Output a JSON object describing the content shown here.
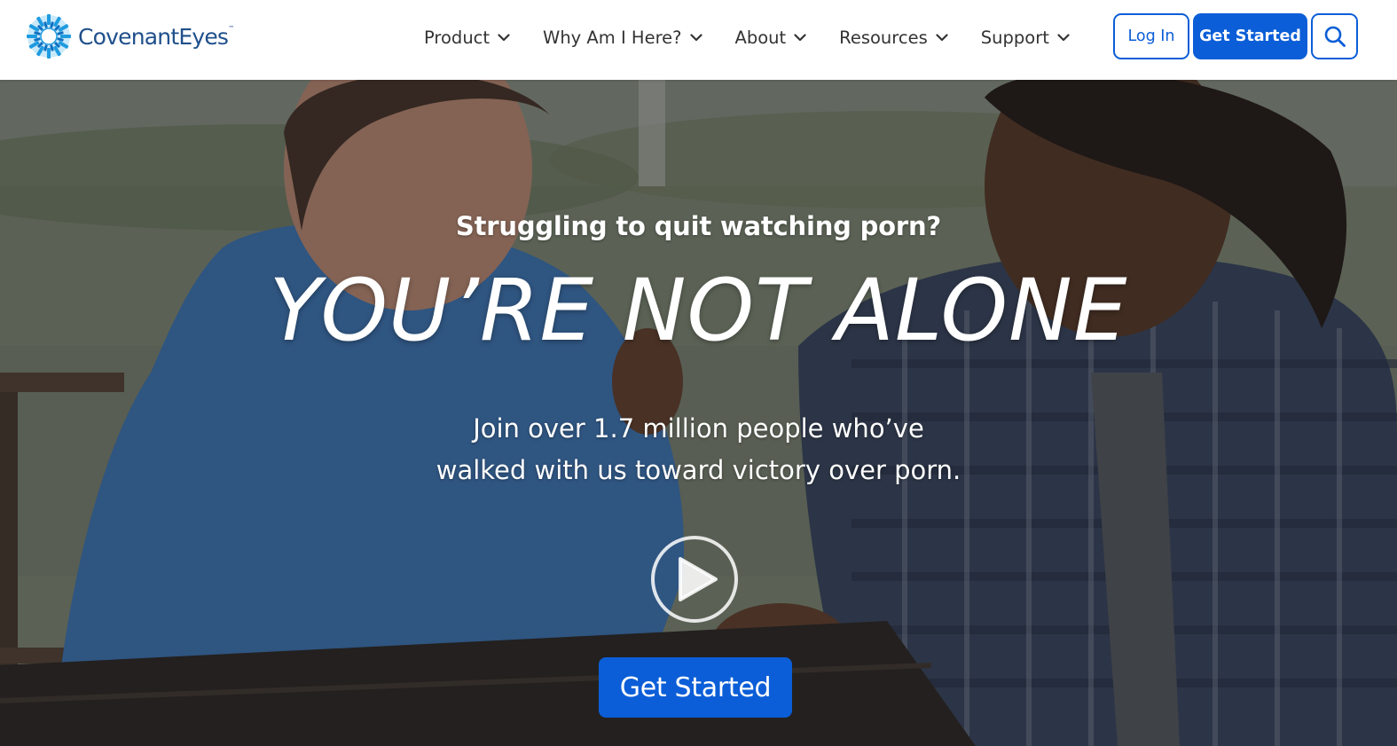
{
  "brand": {
    "name": "CovenantEyes",
    "trademark": "™",
    "primary_color": "#0b5ed7",
    "logo_color": "#1f4f8b"
  },
  "nav": {
    "items": [
      {
        "label": "Product"
      },
      {
        "label": "Why Am I Here?"
      },
      {
        "label": "About"
      },
      {
        "label": "Resources"
      },
      {
        "label": "Support"
      }
    ]
  },
  "header_actions": {
    "login_label": "Log In",
    "get_started_label": "Get Started",
    "search_icon": "search-icon"
  },
  "hero": {
    "eyebrow": "Struggling to quit watching porn?",
    "title": "YOU’RE NOT ALONE",
    "subtext_line1": "Join over 1.7 million people who’ve",
    "subtext_line2": "walked with us toward victory over porn.",
    "play_icon": "play-icon",
    "cta_label": "Get Started"
  }
}
